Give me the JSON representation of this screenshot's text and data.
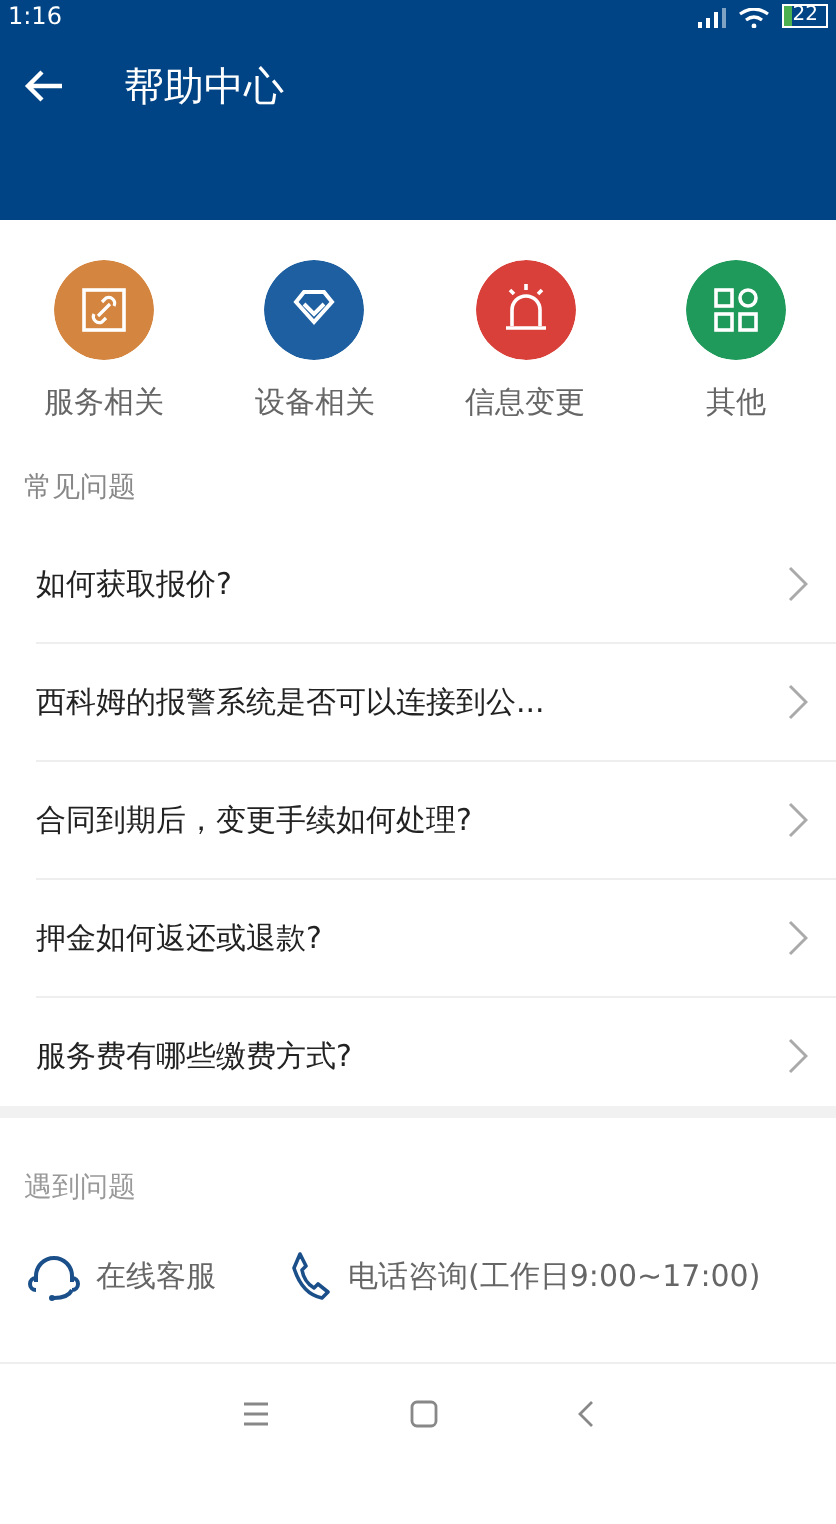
{
  "status_bar": {
    "time": "1:16",
    "battery": "22"
  },
  "header": {
    "title": "帮助中心"
  },
  "categories": [
    {
      "kind": "link",
      "label": "服务相关",
      "color": "#d4853f"
    },
    {
      "kind": "diamond",
      "label": "设备相关",
      "color": "#1d5fa0"
    },
    {
      "kind": "alarm",
      "label": "信息变更",
      "color": "#d9403a"
    },
    {
      "kind": "grid",
      "label": "其他",
      "color": "#1f9a5a"
    }
  ],
  "faq": {
    "title": "常见问题",
    "items": [
      "如何获取报价?",
      "西科姆的报警系统是否可以连接到公...",
      "合同到期后，变更手续如何处理?",
      "押金如何返还或退款?",
      "服务费有哪些缴费方式?"
    ]
  },
  "contact": {
    "title": "遇到问题",
    "items": [
      {
        "kind": "chat",
        "label": "在线客服"
      },
      {
        "kind": "phone",
        "label": "电话咨询(工作日9:00~17:00)"
      }
    ]
  }
}
